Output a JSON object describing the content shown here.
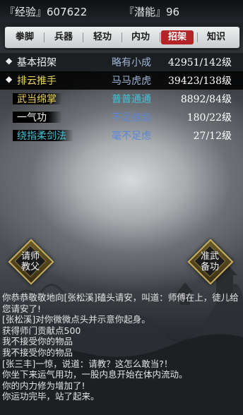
{
  "stats": {
    "exp_label": "『经验』",
    "exp_value": "607622",
    "potential_label": "『潜能』",
    "potential_value": "96"
  },
  "tabs": [
    {
      "label": "拳脚",
      "active": false
    },
    {
      "label": "兵器",
      "active": false
    },
    {
      "label": "轻功",
      "active": false
    },
    {
      "label": "内功",
      "active": false
    },
    {
      "label": "招架",
      "active": true
    },
    {
      "label": "知识",
      "active": false
    }
  ],
  "skills": [
    {
      "bullet": "◆",
      "name": "基本招架",
      "level": "略有小成",
      "progress": "42951/142级",
      "name_color": "#f4f4f4",
      "level_color": "#9fb4d8"
    },
    {
      "bullet": "◆",
      "name": "排云推手",
      "level": "马马虎虎",
      "progress": "39423/138级",
      "name_color": "#e8d35a",
      "level_color": "#9fb4d8"
    },
    {
      "bullet": "",
      "name": "武当绵掌",
      "level": "普普通通",
      "progress": "8892/84级",
      "name_color": "#e8d35a",
      "level_color": "#3fc3d8"
    },
    {
      "bullet": "",
      "name": "一气功",
      "level": "不足挂齿",
      "progress": "180/22级",
      "name_color": "#f4f4f4",
      "level_color": "#5a86d8"
    },
    {
      "bullet": "",
      "name": "绕指柔剑法",
      "level": "毫不足虑",
      "progress": "27/12级",
      "name_color": "#3fc3d8",
      "level_color": "#5a86d8"
    }
  ],
  "buttons": {
    "master_label_1": "请师",
    "master_label_2": "教父",
    "prepare_label_1": "准武",
    "prepare_label_2": "备功"
  },
  "log": [
    "你恭恭敬敬地向[张松溪]磕头请安，叫道：师傅在上，徒儿给您请安了!",
    "[张松溪]对你微微点头并示意你起身。",
    "获得师门贡献点500",
    "我不接受你的物品",
    "我不接受你的物品",
    "[张三丰]一惊，说道：请教？这怎么敢当?！",
    "你坐下来运气用功，一股内息开始在体内流动。",
    "你的内力修为增加了!",
    "你运功完毕，站了起来。"
  ]
}
